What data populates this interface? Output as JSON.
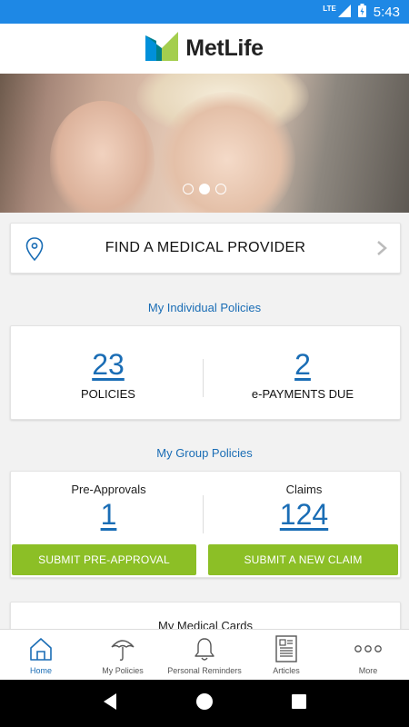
{
  "status_bar": {
    "network": "LTE",
    "time": "5:43",
    "icons": [
      "signal-icon",
      "battery-charging-icon"
    ]
  },
  "header": {
    "brand_name": "MetLife",
    "logo_icon": "metlife-logo-icon",
    "logo_colors": {
      "blue": "#0090da",
      "green": "#a4ce4e",
      "teal": "#007f8a"
    }
  },
  "hero": {
    "carousel_active_index": 1,
    "carousel_count": 3
  },
  "find_provider": {
    "label": "FIND A MEDICAL PROVIDER",
    "icon": "location-pin-icon"
  },
  "individual_policies": {
    "title": "My Individual Policies",
    "policies_count": "23",
    "policies_label": "POLICIES",
    "epayments_count": "2",
    "epayments_label": "e-PAYMENTS DUE"
  },
  "group_policies": {
    "title": "My Group Policies",
    "preapprovals_label": "Pre-Approvals",
    "preapprovals_count": "1",
    "claims_label": "Claims",
    "claims_count": "124",
    "submit_preapproval_label": "SUBMIT PRE-APPROVAL",
    "submit_claim_label": "SUBMIT A NEW CLAIM"
  },
  "medical_cards": {
    "title": "My Medical Cards"
  },
  "bottom_nav": {
    "items": [
      {
        "label": "Home",
        "icon": "home-icon",
        "active": true
      },
      {
        "label": "My Policies",
        "icon": "umbrella-icon",
        "active": false
      },
      {
        "label": "Personal Reminders",
        "icon": "bell-icon",
        "active": false
      },
      {
        "label": "Articles",
        "icon": "article-icon",
        "active": false
      },
      {
        "label": "More",
        "icon": "more-dots-icon",
        "active": false
      }
    ]
  },
  "colors": {
    "accent_blue": "#1a6db5",
    "status_bar": "#1e88e5",
    "button_green": "#8cbf26"
  }
}
